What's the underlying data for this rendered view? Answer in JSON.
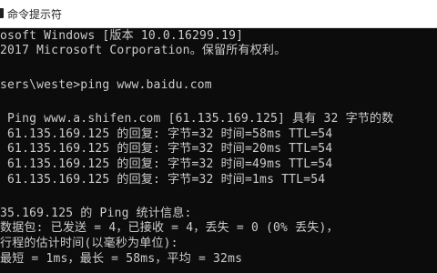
{
  "window": {
    "title": "命令提示符"
  },
  "console": {
    "lines": [
      "osoft Windows [版本 10.0.16299.19]",
      "2017 Microsoft Corporation。保留所有权利。",
      "",
      "sers\\weste>ping www.baidu.com",
      "",
      " Ping www.a.shifen.com [61.135.169.125] 具有 32 字节的数",
      " 61.135.169.125 的回复: 字节=32 时间=58ms TTL=54",
      " 61.135.169.125 的回复: 字节=32 时间=20ms TTL=54",
      " 61.135.169.125 的回复: 字节=32 时间=49ms TTL=54",
      " 61.135.169.125 的回复: 字节=32 时间=1ms TTL=54",
      "",
      "35.169.125 的 Ping 统计信息:",
      "数据包: 已发送 = 4，已接收 = 4，丢失 = 0 (0% 丢失)，",
      "行程的估计时间(以毫秒为单位):",
      "最短 = 1ms，最长 = 58ms，平均 = 32ms"
    ]
  },
  "colors": {
    "console_background": "#0c0c0c",
    "console_text": "#cccccc",
    "titlebar_background": "#ffffff"
  }
}
